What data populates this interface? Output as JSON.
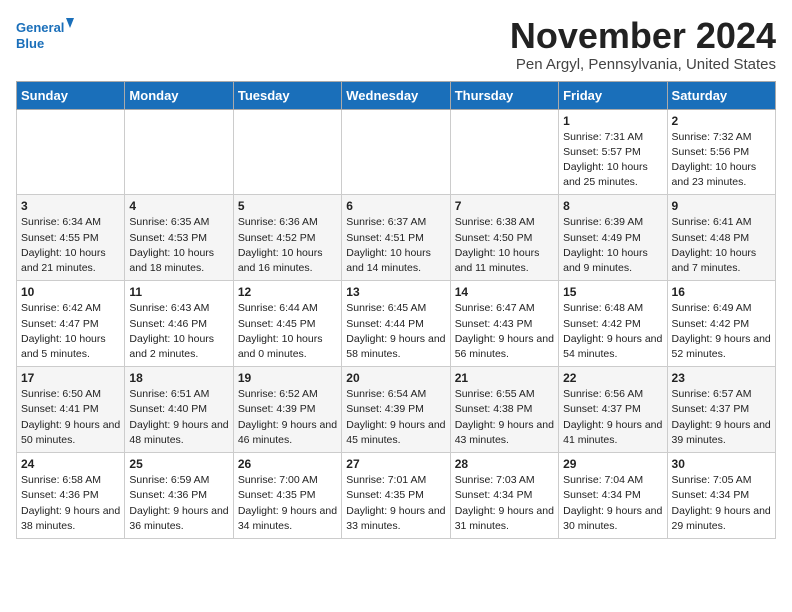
{
  "logo": {
    "line1": "General",
    "line2": "Blue"
  },
  "title": "November 2024",
  "subtitle": "Pen Argyl, Pennsylvania, United States",
  "days_of_week": [
    "Sunday",
    "Monday",
    "Tuesday",
    "Wednesday",
    "Thursday",
    "Friday",
    "Saturday"
  ],
  "weeks": [
    [
      {
        "day": "",
        "info": ""
      },
      {
        "day": "",
        "info": ""
      },
      {
        "day": "",
        "info": ""
      },
      {
        "day": "",
        "info": ""
      },
      {
        "day": "",
        "info": ""
      },
      {
        "day": "1",
        "info": "Sunrise: 7:31 AM\nSunset: 5:57 PM\nDaylight: 10 hours and 25 minutes."
      },
      {
        "day": "2",
        "info": "Sunrise: 7:32 AM\nSunset: 5:56 PM\nDaylight: 10 hours and 23 minutes."
      }
    ],
    [
      {
        "day": "3",
        "info": "Sunrise: 6:34 AM\nSunset: 4:55 PM\nDaylight: 10 hours and 21 minutes."
      },
      {
        "day": "4",
        "info": "Sunrise: 6:35 AM\nSunset: 4:53 PM\nDaylight: 10 hours and 18 minutes."
      },
      {
        "day": "5",
        "info": "Sunrise: 6:36 AM\nSunset: 4:52 PM\nDaylight: 10 hours and 16 minutes."
      },
      {
        "day": "6",
        "info": "Sunrise: 6:37 AM\nSunset: 4:51 PM\nDaylight: 10 hours and 14 minutes."
      },
      {
        "day": "7",
        "info": "Sunrise: 6:38 AM\nSunset: 4:50 PM\nDaylight: 10 hours and 11 minutes."
      },
      {
        "day": "8",
        "info": "Sunrise: 6:39 AM\nSunset: 4:49 PM\nDaylight: 10 hours and 9 minutes."
      },
      {
        "day": "9",
        "info": "Sunrise: 6:41 AM\nSunset: 4:48 PM\nDaylight: 10 hours and 7 minutes."
      }
    ],
    [
      {
        "day": "10",
        "info": "Sunrise: 6:42 AM\nSunset: 4:47 PM\nDaylight: 10 hours and 5 minutes."
      },
      {
        "day": "11",
        "info": "Sunrise: 6:43 AM\nSunset: 4:46 PM\nDaylight: 10 hours and 2 minutes."
      },
      {
        "day": "12",
        "info": "Sunrise: 6:44 AM\nSunset: 4:45 PM\nDaylight: 10 hours and 0 minutes."
      },
      {
        "day": "13",
        "info": "Sunrise: 6:45 AM\nSunset: 4:44 PM\nDaylight: 9 hours and 58 minutes."
      },
      {
        "day": "14",
        "info": "Sunrise: 6:47 AM\nSunset: 4:43 PM\nDaylight: 9 hours and 56 minutes."
      },
      {
        "day": "15",
        "info": "Sunrise: 6:48 AM\nSunset: 4:42 PM\nDaylight: 9 hours and 54 minutes."
      },
      {
        "day": "16",
        "info": "Sunrise: 6:49 AM\nSunset: 4:42 PM\nDaylight: 9 hours and 52 minutes."
      }
    ],
    [
      {
        "day": "17",
        "info": "Sunrise: 6:50 AM\nSunset: 4:41 PM\nDaylight: 9 hours and 50 minutes."
      },
      {
        "day": "18",
        "info": "Sunrise: 6:51 AM\nSunset: 4:40 PM\nDaylight: 9 hours and 48 minutes."
      },
      {
        "day": "19",
        "info": "Sunrise: 6:52 AM\nSunset: 4:39 PM\nDaylight: 9 hours and 46 minutes."
      },
      {
        "day": "20",
        "info": "Sunrise: 6:54 AM\nSunset: 4:39 PM\nDaylight: 9 hours and 45 minutes."
      },
      {
        "day": "21",
        "info": "Sunrise: 6:55 AM\nSunset: 4:38 PM\nDaylight: 9 hours and 43 minutes."
      },
      {
        "day": "22",
        "info": "Sunrise: 6:56 AM\nSunset: 4:37 PM\nDaylight: 9 hours and 41 minutes."
      },
      {
        "day": "23",
        "info": "Sunrise: 6:57 AM\nSunset: 4:37 PM\nDaylight: 9 hours and 39 minutes."
      }
    ],
    [
      {
        "day": "24",
        "info": "Sunrise: 6:58 AM\nSunset: 4:36 PM\nDaylight: 9 hours and 38 minutes."
      },
      {
        "day": "25",
        "info": "Sunrise: 6:59 AM\nSunset: 4:36 PM\nDaylight: 9 hours and 36 minutes."
      },
      {
        "day": "26",
        "info": "Sunrise: 7:00 AM\nSunset: 4:35 PM\nDaylight: 9 hours and 34 minutes."
      },
      {
        "day": "27",
        "info": "Sunrise: 7:01 AM\nSunset: 4:35 PM\nDaylight: 9 hours and 33 minutes."
      },
      {
        "day": "28",
        "info": "Sunrise: 7:03 AM\nSunset: 4:34 PM\nDaylight: 9 hours and 31 minutes."
      },
      {
        "day": "29",
        "info": "Sunrise: 7:04 AM\nSunset: 4:34 PM\nDaylight: 9 hours and 30 minutes."
      },
      {
        "day": "30",
        "info": "Sunrise: 7:05 AM\nSunset: 4:34 PM\nDaylight: 9 hours and 29 minutes."
      }
    ]
  ]
}
